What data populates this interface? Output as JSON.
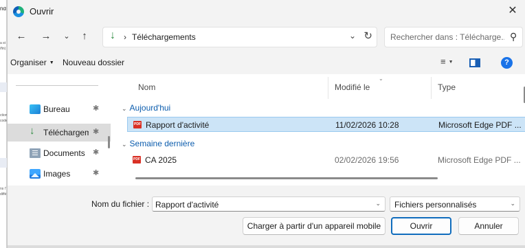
{
  "background_app": {
    "glyph": "nd",
    "lines": [
      "a st",
      "/fin) |",
      "ction",
      "code",
      "ns l'",
      "diffé"
    ]
  },
  "dialog": {
    "title": "Ouvrir",
    "close_glyph": "✕"
  },
  "navigation": {
    "back": "←",
    "forward": "→",
    "recent": "⌄",
    "up": "↑",
    "address": {
      "icon": "↓",
      "separator": "›",
      "path": "Téléchargements",
      "dropdown": "⌄",
      "refresh": "↻"
    },
    "search": {
      "placeholder": "Rechercher dans : Télécharge...",
      "icon": "⚲"
    }
  },
  "commands": {
    "organize": "Organiser",
    "organize_caret": "▼",
    "new_folder": "Nouveau dossier",
    "view_glyph": "≡",
    "view_caret": "▼",
    "help": "?"
  },
  "nav_pane": {
    "items": [
      {
        "label": "Bureau",
        "pin": "✱"
      },
      {
        "label": "Téléchargements",
        "pin": "✱",
        "icon": "↓",
        "selected": true
      },
      {
        "label": "Documents",
        "pin": "✱"
      },
      {
        "label": "Images",
        "pin": "✱"
      }
    ]
  },
  "file_list": {
    "columns": {
      "name": "Nom",
      "date": "Modifié le",
      "type": "Type"
    },
    "sort_caret": "⌄",
    "groups": [
      {
        "label": "Aujourd'hui",
        "chevron": "⌄",
        "files": [
          {
            "name": "Rapport d'activité",
            "date": "11/02/2026 10:28",
            "type": "Microsoft Edge PDF ...",
            "selected": true,
            "icon_text": "PDF"
          }
        ]
      },
      {
        "label": "Semaine dernière",
        "chevron": "⌄",
        "files": [
          {
            "name": "CA 2025",
            "date": "02/02/2026 19:56",
            "type": "Microsoft Edge PDF ...",
            "selected": false,
            "icon_text": "PDF"
          }
        ]
      }
    ]
  },
  "bottom": {
    "filename_label": "Nom du fichier :",
    "filename_value": "Rapport d'activité",
    "filename_dropdown": "⌄",
    "filetype": "Fichiers personnalisés",
    "filetype_dropdown": "⌄",
    "mobile_button": "Charger à partir d'un appareil mobile",
    "open_button": "Ouvrir",
    "cancel_button": "Annuler"
  },
  "colors": {
    "accent": "#0f6cbd",
    "selection": "#cce4f7",
    "group_text": "#0b5cad",
    "pdf_red": "#d93025",
    "download_green": "#2b8a3e"
  }
}
